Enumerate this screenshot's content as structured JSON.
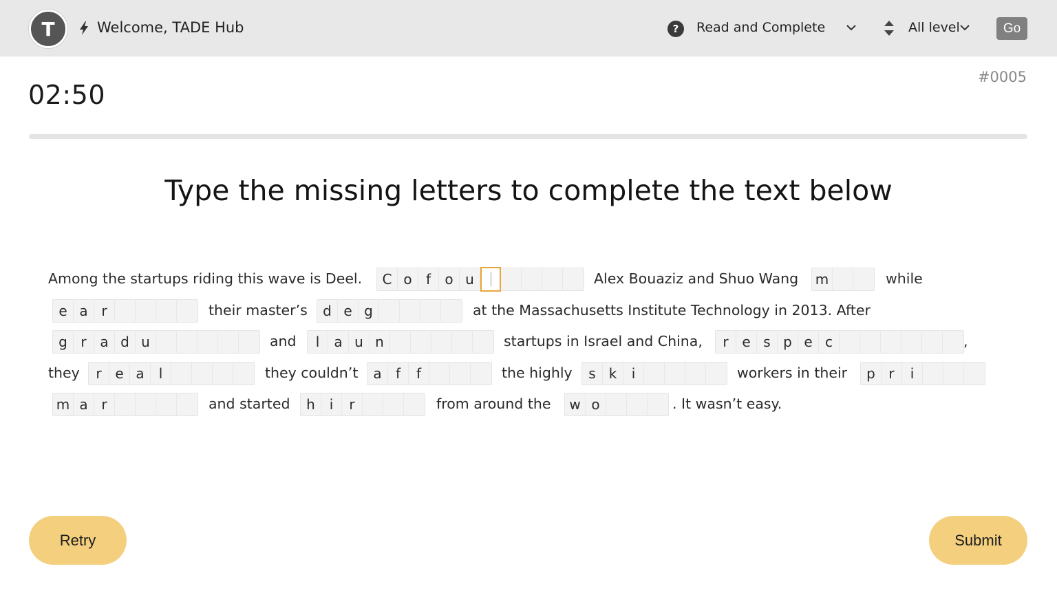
{
  "header": {
    "avatar_letter": "T",
    "welcome": "Welcome, TADE Hub",
    "mode_label": "Read and Complete",
    "level_label": "All level",
    "go_label": "Go",
    "icons": [
      "bolt-icon",
      "help-icon",
      "chevron-down-icon",
      "sort-icon"
    ]
  },
  "timer": "02:50",
  "question_id": "#0005",
  "progress": 0,
  "heading": "Type the missing letters to complete the text below",
  "passage": {
    "lines": [
      [
        {
          "t": "text",
          "v": "Among the startups riding this wave is Deel."
        },
        {
          "t": "gap",
          "letters": [
            "C",
            "o",
            "f",
            "o",
            "u"
          ],
          "blanks": 5,
          "active_index": 5
        },
        {
          "t": "text",
          "v": "Alex Bouaziz and Shuo Wang"
        },
        {
          "t": "gap",
          "letters": [
            "m"
          ],
          "blanks": 2
        },
        {
          "t": "text",
          "v": "while"
        }
      ],
      [
        {
          "t": "gap",
          "letters": [
            "e",
            "a",
            "r"
          ],
          "blanks": 4
        },
        {
          "t": "text",
          "v": "their master’s"
        },
        {
          "t": "gap",
          "letters": [
            "d",
            "e",
            "g"
          ],
          "blanks": 4
        },
        {
          "t": "text",
          "v": "at the Massachusetts Institute Technology in 2013. After"
        }
      ],
      [
        {
          "t": "gap",
          "letters": [
            "g",
            "r",
            "a",
            "d",
            "u"
          ],
          "blanks": 5
        },
        {
          "t": "text",
          "v": "and"
        },
        {
          "t": "gap",
          "letters": [
            "l",
            "a",
            "u",
            "n"
          ],
          "blanks": 5
        },
        {
          "t": "text",
          "v": "startups in Israel and China,"
        },
        {
          "t": "gap",
          "letters": [
            "r",
            "e",
            "s",
            "p",
            "e",
            "c"
          ],
          "blanks": 6
        },
        {
          "t": "text",
          "v": ","
        }
      ],
      [
        {
          "t": "text",
          "v": "they"
        },
        {
          "t": "gap",
          "letters": [
            "r",
            "e",
            "a",
            "l"
          ],
          "blanks": 4
        },
        {
          "t": "text",
          "v": "they couldn’t"
        },
        {
          "t": "gap",
          "letters": [
            "a",
            "f",
            "f"
          ],
          "blanks": 3
        },
        {
          "t": "text",
          "v": "the highly"
        },
        {
          "t": "gap",
          "letters": [
            "s",
            "k",
            "i"
          ],
          "blanks": 4
        },
        {
          "t": "text",
          "v": "workers in their"
        },
        {
          "t": "gap",
          "letters": [
            "p",
            "r",
            "i"
          ],
          "blanks": 3
        }
      ],
      [
        {
          "t": "gap",
          "letters": [
            "m",
            "a",
            "r"
          ],
          "blanks": 4
        },
        {
          "t": "text",
          "v": "and started"
        },
        {
          "t": "gap",
          "letters": [
            "h",
            "i",
            "r"
          ],
          "blanks": 3
        },
        {
          "t": "text",
          "v": "from around the"
        },
        {
          "t": "gap",
          "letters": [
            "w",
            "o"
          ],
          "blanks": 3
        },
        {
          "t": "text",
          "v": ". It wasn’t easy."
        }
      ]
    ]
  },
  "buttons": {
    "retry": "Retry",
    "submit": "Submit"
  },
  "colors": {
    "accent": "#f3cf7e",
    "active_border": "#e9a53a",
    "topbar": "#e8e8e8",
    "avatar": "#555555",
    "go_button": "#808080"
  }
}
